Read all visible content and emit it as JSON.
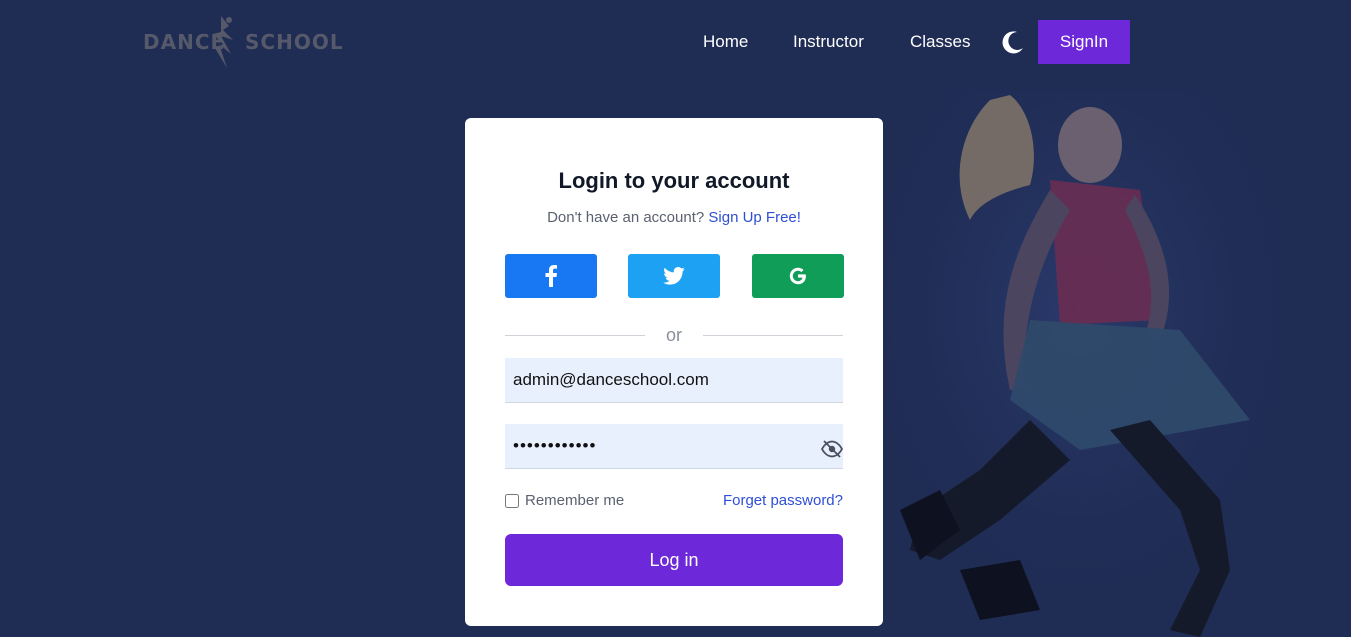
{
  "header": {
    "logo_left": "DANCE",
    "logo_right": "SCHOOL",
    "nav": [
      "Home",
      "Instructor",
      "Classes"
    ],
    "theme_icon": "moon-icon",
    "signin_label": "SignIn"
  },
  "login_card": {
    "title": "Login to your account",
    "no_account_text": "Don't have an account?",
    "signup_link": "Sign Up Free!",
    "social": [
      {
        "icon": "facebook-icon",
        "color": "#1877f2"
      },
      {
        "icon": "twitter-icon",
        "color": "#1da1f2"
      },
      {
        "icon": "google-icon",
        "color": "#0f9d58"
      }
    ],
    "divider": "or",
    "email_value": "admin@danceschool.com",
    "password_value": "••••••••••••",
    "password_icon": "eye-slash-icon",
    "remember_label": "Remember me",
    "forgot_label": "Forget password?",
    "login_label": "Log in"
  },
  "colors": {
    "background": "#1f2c54",
    "accent": "#6d28d9",
    "link": "#2f4fd6"
  }
}
